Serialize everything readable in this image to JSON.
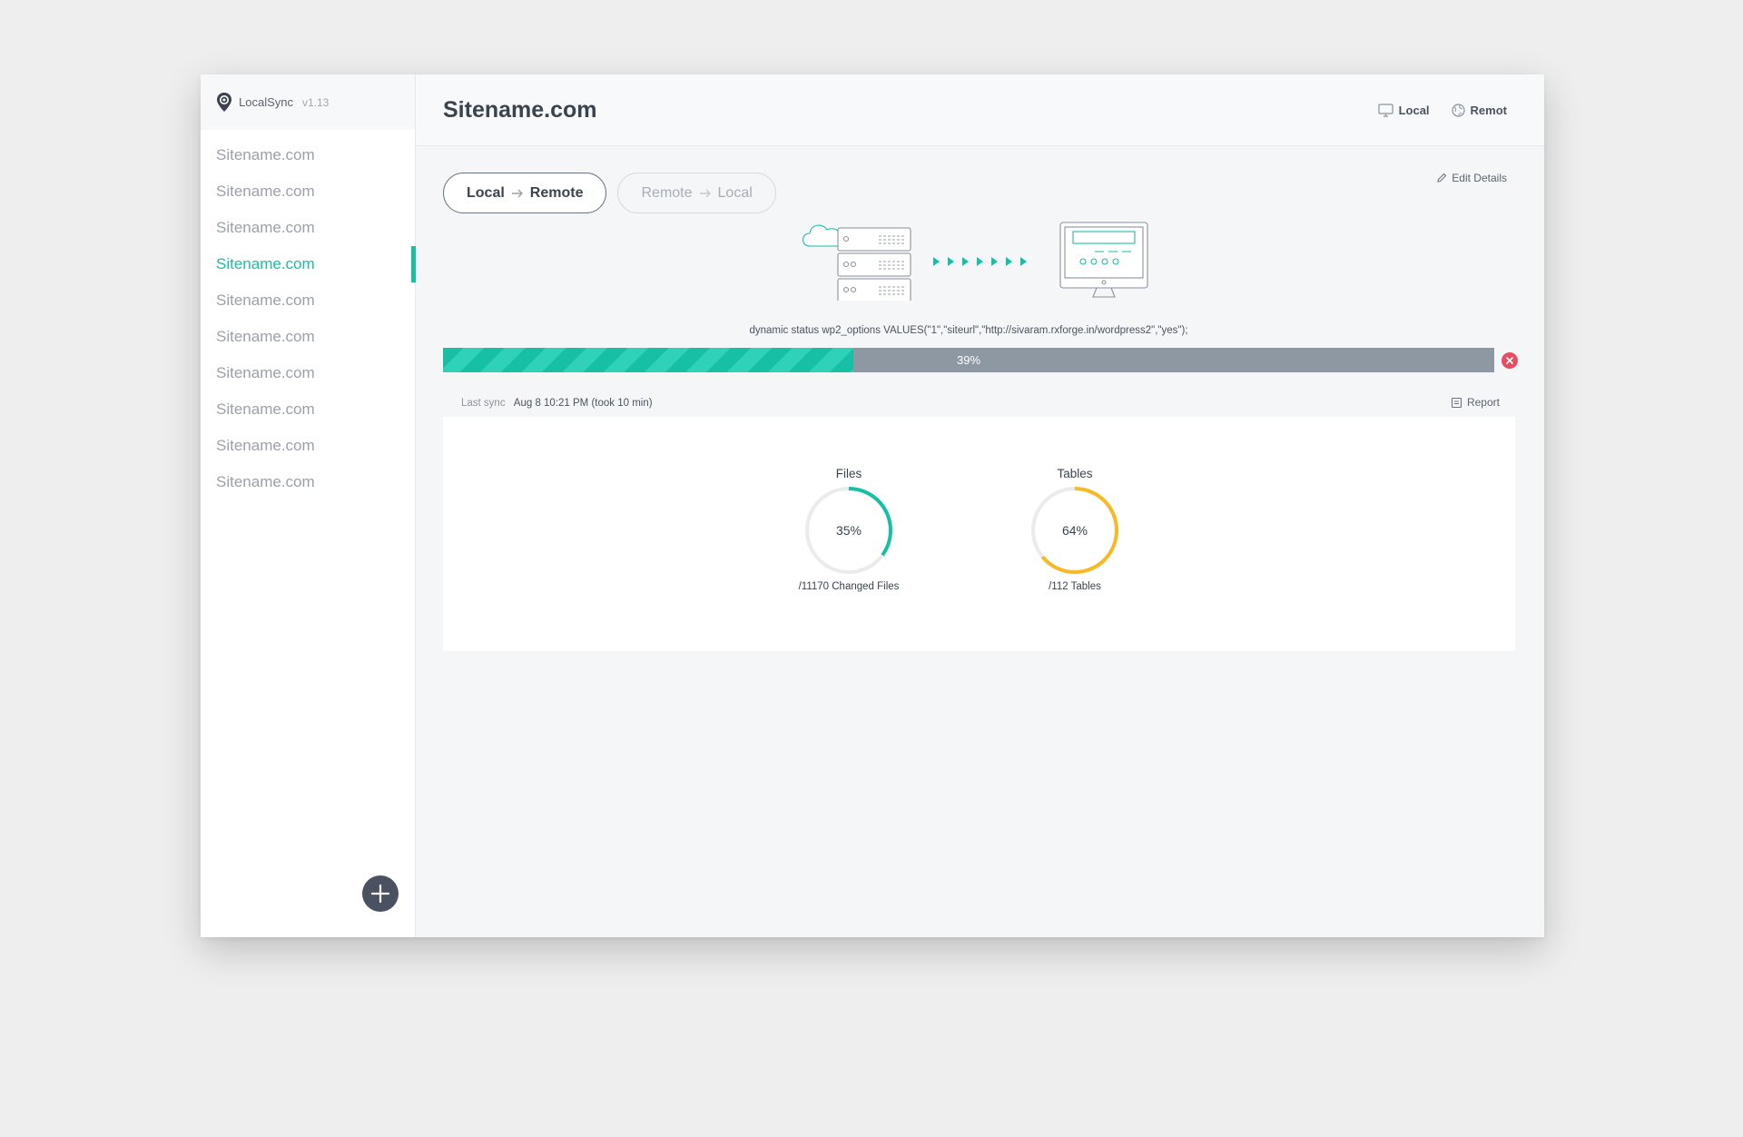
{
  "app": {
    "name": "LocalSync",
    "version": "v1.13"
  },
  "sidebar": {
    "sites": [
      {
        "label": "Sitename.com"
      },
      {
        "label": "Sitename.com"
      },
      {
        "label": "Sitename.com"
      },
      {
        "label": "Sitename.com",
        "active": true
      },
      {
        "label": "Sitename.com"
      },
      {
        "label": "Sitename.com"
      },
      {
        "label": "Sitename.com"
      },
      {
        "label": "Sitename.com"
      },
      {
        "label": "Sitename.com"
      },
      {
        "label": "Sitename.com"
      }
    ],
    "add_icon": "plus-icon"
  },
  "header": {
    "title": "Sitename.com",
    "local_label": "Local",
    "remote_label": "Remot"
  },
  "direction_tabs": [
    {
      "from": "Local",
      "to": "Remote",
      "active": true
    },
    {
      "from": "Remote",
      "to": "Local",
      "active": false
    }
  ],
  "edit_details_label": "Edit Details",
  "status_text": "dynamic status wp2_options VALUES(\"1\",\"siteurl\",\"http://sivaram.rxforge.in/wordpress2\",\"yes\");",
  "progress": {
    "percent": 39,
    "label": "39%"
  },
  "last_sync": {
    "label": "Last sync",
    "value": "Aug 8 10:21 PM (took 10 min)"
  },
  "report_label": "Report",
  "stats": {
    "files": {
      "title": "Files",
      "percent": 35,
      "label": "35%",
      "sub": "/11170 Changed Files",
      "color": "#17bfa5"
    },
    "tables": {
      "title": "Tables",
      "percent": 64,
      "label": "64%",
      "sub": "/112 Tables",
      "color": "#f7b924"
    }
  },
  "colors": {
    "accent": "#17bfa5",
    "progress_track": "#8e98a3",
    "cancel": "#e84c5f",
    "tables_ring": "#f7b924"
  }
}
